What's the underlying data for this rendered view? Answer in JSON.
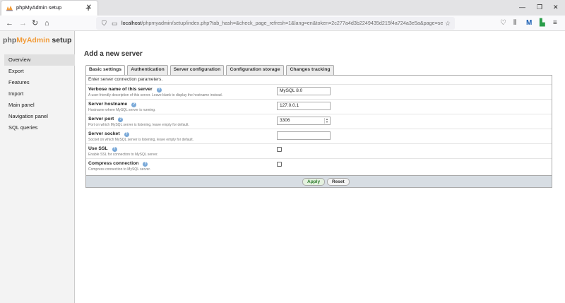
{
  "browser": {
    "tab_title": "phpMyAdmin setup",
    "tab_close": "✕",
    "new_tab": "+",
    "url_host": "localhost",
    "url_rest": "/phpmyadmin/setup/index.php?tab_hash=&check_page_refresh=1&lang=en&token=2c277a4d3b2249435d215f4a724a3e5a&page=se"
  },
  "sidebar": {
    "logo_php": "php",
    "logo_my": "MyAdmin",
    "logo_setup": " setup",
    "items": [
      {
        "label": "Overview"
      },
      {
        "label": "Export"
      },
      {
        "label": "Features"
      },
      {
        "label": "Import"
      },
      {
        "label": "Main panel"
      },
      {
        "label": "Navigation panel"
      },
      {
        "label": "SQL queries"
      }
    ]
  },
  "main": {
    "title": "Add a new server",
    "tabs": [
      {
        "label": "Basic settings"
      },
      {
        "label": "Authentication"
      },
      {
        "label": "Server configuration"
      },
      {
        "label": "Configuration storage"
      },
      {
        "label": "Changes tracking"
      }
    ],
    "form_description": "Enter server connection parameters.",
    "rows": [
      {
        "label": "Verbose name of this server",
        "desc": "A user-friendly description of this server. Leave blank to display the hostname instead.",
        "value": "MySQL 8.0"
      },
      {
        "label": "Server hostname",
        "desc": "Hostname where MySQL server is running.",
        "value": "127.0.0.1"
      },
      {
        "label": "Server port",
        "desc": "Port on which MySQL server is listening, leave empty for default.",
        "value": "3306"
      },
      {
        "label": "Server socket",
        "desc": "Socket on which MySQL server is listening, leave empty for default.",
        "value": ""
      },
      {
        "label": "Use SSL",
        "desc": "Enable SSL for connection to MySQL server."
      },
      {
        "label": "Compress connection",
        "desc": "Compress connection to MySQL server."
      }
    ],
    "apply_label": "Apply",
    "reset_label": "Reset"
  }
}
